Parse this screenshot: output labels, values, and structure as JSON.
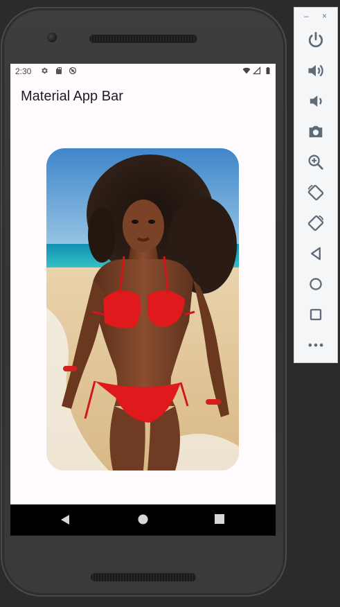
{
  "status_bar": {
    "time": "2:30",
    "left_icons": [
      "gear-icon",
      "sd-card-icon",
      "sync-disabled-icon"
    ],
    "right_icons": [
      "wifi-icon",
      "signal-icon",
      "battery-icon"
    ]
  },
  "app_bar": {
    "title": "Material App Bar"
  },
  "content": {
    "image_subject": "woman in red bikini on beach"
  },
  "nav_bar": {
    "buttons": [
      "back-icon",
      "home-icon",
      "overview-icon"
    ]
  },
  "emulator_toolbar": {
    "window_buttons": [
      "–",
      "×"
    ],
    "buttons": [
      {
        "name": "power-button",
        "icon": "power-icon"
      },
      {
        "name": "volume-up-button",
        "icon": "volume-up-icon"
      },
      {
        "name": "volume-down-button",
        "icon": "volume-down-icon"
      },
      {
        "name": "screenshot-button",
        "icon": "camera-icon"
      },
      {
        "name": "zoom-button",
        "icon": "zoom-in-icon"
      },
      {
        "name": "rotate-left-button",
        "icon": "rotate-left-icon"
      },
      {
        "name": "rotate-right-button",
        "icon": "rotate-right-icon"
      },
      {
        "name": "back-button",
        "icon": "back-icon"
      },
      {
        "name": "home-button",
        "icon": "home-icon"
      },
      {
        "name": "overview-button",
        "icon": "overview-icon"
      },
      {
        "name": "more-button",
        "icon": "more-icon"
      }
    ]
  },
  "colors": {
    "screen_background": "#fffbfe",
    "toolbar_icon": "#5f6b77",
    "bikini_red": "#e0191c"
  }
}
